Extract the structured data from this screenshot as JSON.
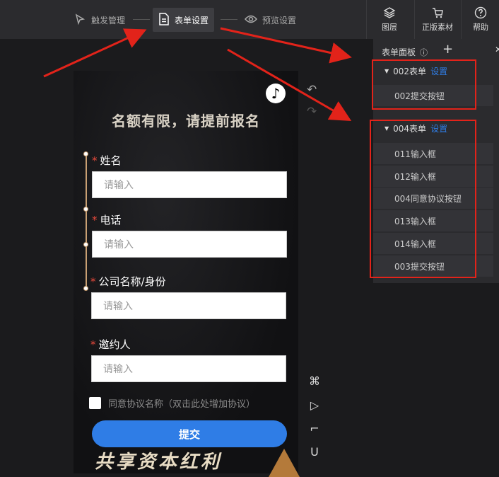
{
  "steps": [
    {
      "label": "触发管理",
      "icon": "trigger-icon"
    },
    {
      "label": "表单设置",
      "icon": "document-icon"
    },
    {
      "label": "预览设置",
      "icon": "eye-icon"
    }
  ],
  "tools": [
    {
      "label": "图层",
      "icon": "layers-icon"
    },
    {
      "label": "正版素材",
      "icon": "cart-icon"
    },
    {
      "label": "帮助",
      "icon": "help-icon"
    }
  ],
  "form": {
    "headline": "名额有限，请提前报名",
    "required_mark": "*",
    "fields": [
      {
        "label": "姓名",
        "placeholder": "请输入"
      },
      {
        "label": "电话",
        "placeholder": "请输入"
      },
      {
        "label": "公司名称/身份",
        "placeholder": "请输入"
      },
      {
        "label": "邀约人",
        "placeholder": "请输入"
      }
    ],
    "agreement": "同意协议名称（双击此处增加协议）",
    "submit": "提交",
    "promo": "共享资本红利"
  },
  "panel": {
    "title": "表单面板",
    "add": "+",
    "groups": [
      {
        "title": "002表单",
        "settings": "设置",
        "items": [
          "002提交按钮"
        ]
      },
      {
        "title": "004表单",
        "settings": "设置",
        "items": [
          "011输入框",
          "012输入框",
          "004同意协议按钮",
          "013输入框",
          "014输入框",
          "003提交按钮"
        ]
      }
    ]
  },
  "colors": {
    "accent": "#2f7de6",
    "required": "#e84a3c",
    "annotation": "#e2231a"
  }
}
